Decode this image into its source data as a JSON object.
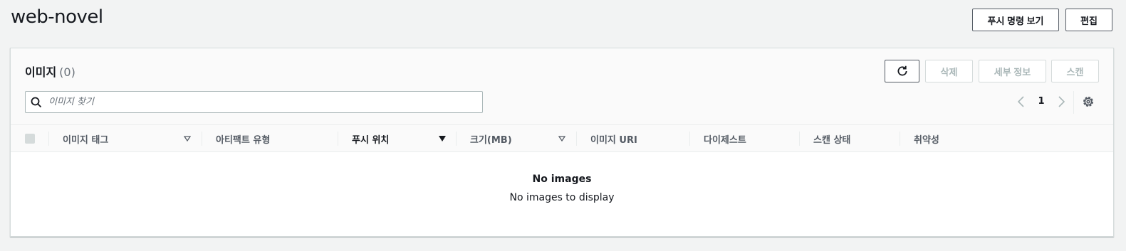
{
  "header": {
    "title": "web-novel",
    "view_push_commands_label": "푸시 명령 보기",
    "edit_label": "편집"
  },
  "images_panel": {
    "title": "이미지",
    "count": "(0)",
    "toolbar": {
      "refresh_icon": "refresh-icon",
      "delete_label": "삭제",
      "details_label": "세부 정보",
      "scan_label": "스캔"
    },
    "search": {
      "placeholder": "이미지 찾기",
      "value": ""
    },
    "pagination": {
      "current_page": "1"
    },
    "columns": [
      {
        "label": "이미지 태그",
        "sortable": true,
        "sorted": false
      },
      {
        "label": "아티팩트 유형",
        "sortable": false,
        "sorted": false
      },
      {
        "label": "푸시 위치",
        "sortable": true,
        "sorted": true,
        "direction": "descending"
      },
      {
        "label": "크기(MB)",
        "sortable": true,
        "sorted": false
      },
      {
        "label": "이미지 URI",
        "sortable": false,
        "sorted": false
      },
      {
        "label": "다이제스트",
        "sortable": false,
        "sorted": false
      },
      {
        "label": "스캔 상태",
        "sortable": false,
        "sorted": false
      },
      {
        "label": "취약성",
        "sortable": false,
        "sorted": false
      }
    ],
    "empty_state": {
      "title": "No images",
      "description": "No images to display"
    }
  },
  "colors": {
    "background": "#f2f3f3",
    "text": "#16191f",
    "muted_text": "#545b64",
    "disabled_text": "#aab7b8",
    "border": "#d5dbdb"
  }
}
